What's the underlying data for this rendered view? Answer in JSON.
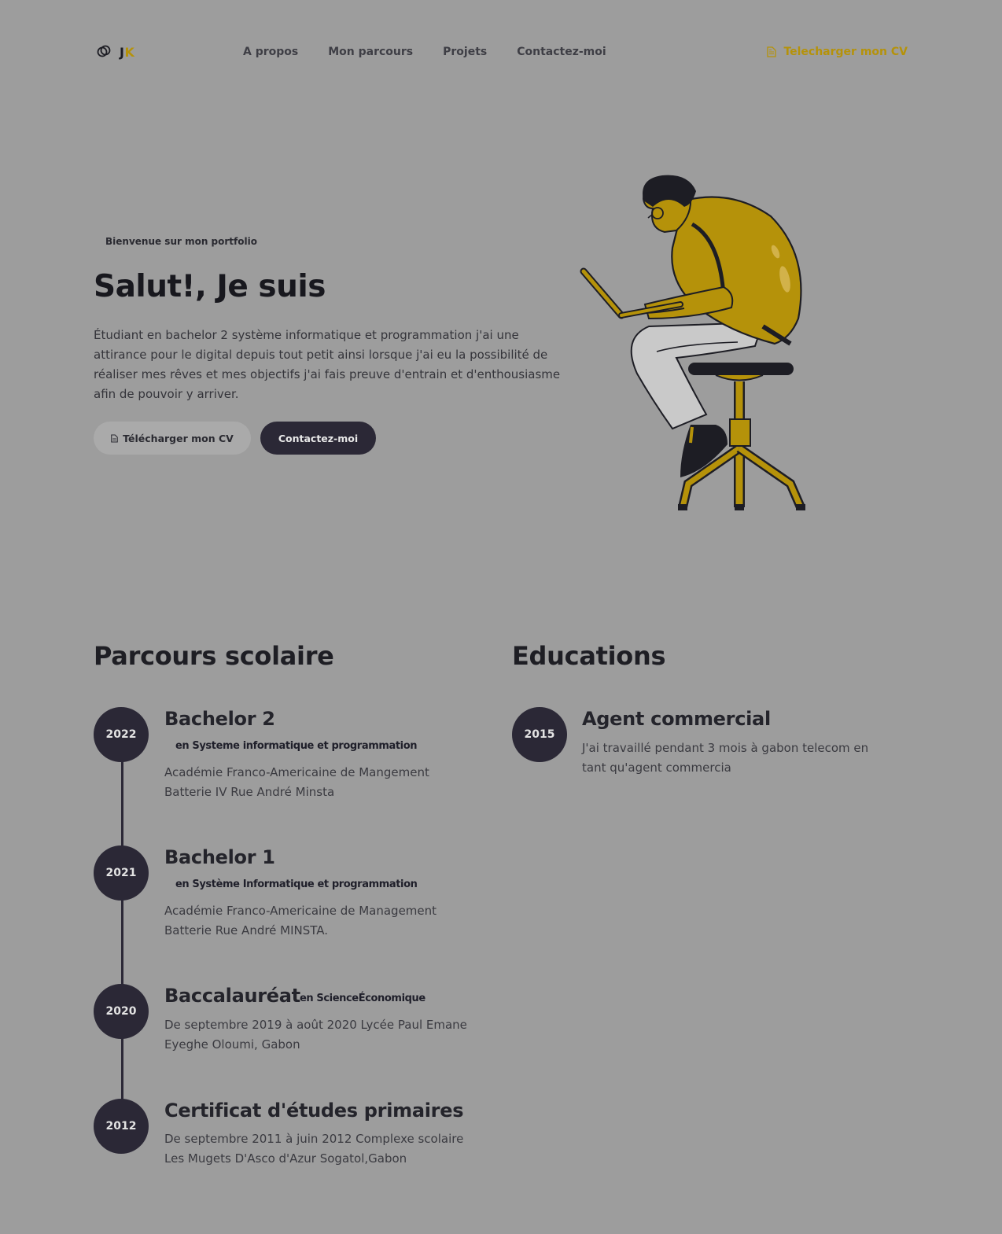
{
  "colors": {
    "accent": "#b5920a",
    "dark": "#2b2836",
    "background": "#9d9d9d"
  },
  "nav": {
    "logo": {
      "icon": "link-logo-icon",
      "letter1": "J",
      "letter2": "K"
    },
    "links": [
      "A propos",
      "Mon parcours",
      "Projets",
      "Contactez-moi"
    ],
    "cv_icon": "document-icon",
    "cv_label": "Telecharger mon CV"
  },
  "hero": {
    "subtitle": "Bienvenue sur mon portfolio",
    "title": "Salut!, Je suis",
    "description": "Étudiant en bachelor 2 système informatique et programmation j'ai une attirance pour le digital depuis tout petit ainsi lorsque j'ai eu la possibilité de réaliser mes rêves et mes objectifs j'ai fais preuve d'entrain et d'enthousiasme afin de pouvoir y arriver.",
    "cv_button": "Télécharger mon CV",
    "contact_button": "Contactez-moi"
  },
  "parcours": {
    "title": "Parcours scolaire",
    "items": [
      {
        "year": "2022",
        "title": "Bachelor 2",
        "tag": "en Systeme informatique et programmation",
        "desc": "Académie Franco-Americaine de Mangement Batterie IV Rue André Minsta"
      },
      {
        "year": "2021",
        "title": "Bachelor 1",
        "tag": "en Système Informatique et programmation",
        "desc": "Académie Franco-Americaine de Management Batterie Rue André MINSTA."
      },
      {
        "year": "2020",
        "title": "Baccalauréat",
        "tag": "en ScienceÉconomique",
        "desc": "De septembre 2019 à août 2020 Lycée Paul Emane Eyeghe Oloumi, Gabon"
      },
      {
        "year": "2012",
        "title": "Certificat d'études primaires",
        "tag": "",
        "desc": "De septembre 2011 à juin 2012 Complexe scolaire Les Mugets D'Asco d'Azur Sogatol,Gabon"
      }
    ]
  },
  "educations": {
    "title": "Educations",
    "items": [
      {
        "year": "2015",
        "title": "Agent commercial",
        "desc": "J'ai travaillé pendant 3 mois à gabon telecom en tant qu'agent commercia"
      }
    ]
  }
}
